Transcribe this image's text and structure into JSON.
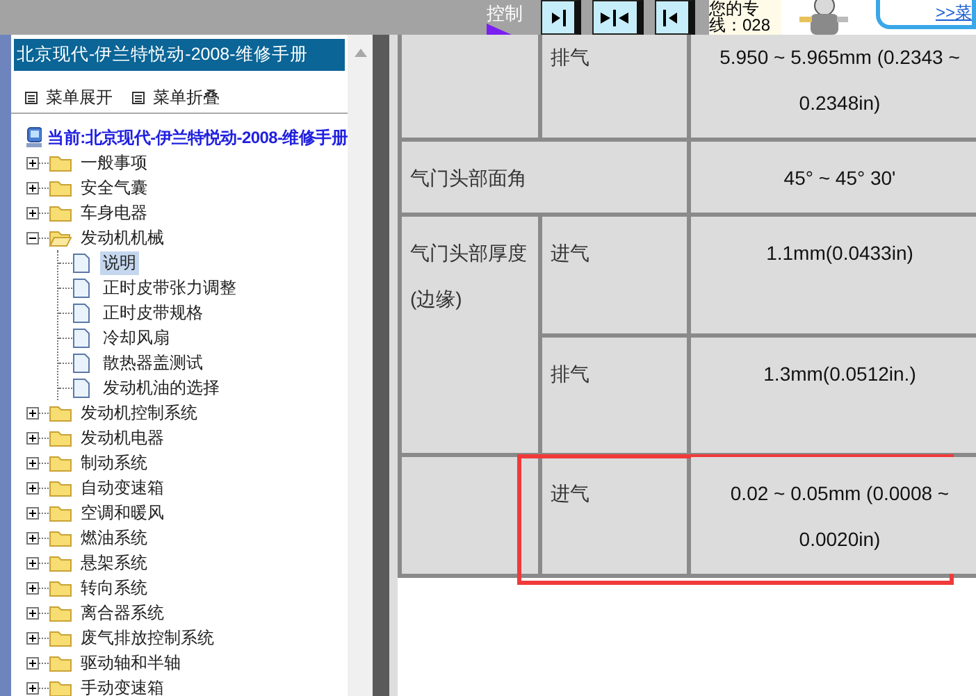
{
  "top_bar": {
    "control_label": "控制",
    "banner": {
      "lines": [
        "您的专",
        "线：028"
      ],
      "link": ">>菜"
    }
  },
  "sidebar": {
    "title": "北京现代-伊兰特悦动-2008-维修手册",
    "actions": [
      "菜单展开",
      "菜单折叠"
    ],
    "current": "当前:北京现代-伊兰特悦动-2008-维修手册",
    "tree": [
      {
        "label": "一般事项",
        "kind": "folder",
        "expanded": false,
        "selected": false
      },
      {
        "label": "安全气囊",
        "kind": "folder",
        "expanded": false,
        "selected": false
      },
      {
        "label": "车身电器",
        "kind": "folder",
        "expanded": false,
        "selected": false
      },
      {
        "label": "发动机机械",
        "kind": "folder",
        "expanded": true,
        "selected": false,
        "children": [
          {
            "label": "说明",
            "kind": "page",
            "selected": true
          },
          {
            "label": "正时皮带张力调整",
            "kind": "page",
            "selected": false
          },
          {
            "label": "正时皮带规格",
            "kind": "page",
            "selected": false
          },
          {
            "label": "冷却风扇",
            "kind": "page",
            "selected": false
          },
          {
            "label": "散热器盖测试",
            "kind": "page",
            "selected": false
          },
          {
            "label": "发动机油的选择",
            "kind": "page",
            "selected": false
          }
        ]
      },
      {
        "label": "发动机控制系统",
        "kind": "folder",
        "expanded": false,
        "selected": false
      },
      {
        "label": "发动机电器",
        "kind": "folder",
        "expanded": false,
        "selected": false
      },
      {
        "label": "制动系统",
        "kind": "folder",
        "expanded": false,
        "selected": false
      },
      {
        "label": "自动变速箱",
        "kind": "folder",
        "expanded": false,
        "selected": false
      },
      {
        "label": "空调和暖风",
        "kind": "folder",
        "expanded": false,
        "selected": false
      },
      {
        "label": "燃油系统",
        "kind": "folder",
        "expanded": false,
        "selected": false
      },
      {
        "label": "悬架系统",
        "kind": "folder",
        "expanded": false,
        "selected": false
      },
      {
        "label": "转向系统",
        "kind": "folder",
        "expanded": false,
        "selected": false
      },
      {
        "label": "离合器系统",
        "kind": "folder",
        "expanded": false,
        "selected": false
      },
      {
        "label": "废气排放控制系统",
        "kind": "folder",
        "expanded": false,
        "selected": false
      },
      {
        "label": "驱动轴和半轴",
        "kind": "folder",
        "expanded": false,
        "selected": false
      },
      {
        "label": "手动变速箱",
        "kind": "folder",
        "expanded": false,
        "selected": false
      }
    ]
  },
  "spec_table": {
    "rows": [
      {
        "kind": "group",
        "items": [
          {
            "sub": "排气",
            "value": "5.950 ~ 5.965mm (0.2343 ~ 0.2348in)",
            "highlighted": false
          }
        ]
      },
      {
        "kind": "merged",
        "label": "气门头部面角",
        "value": "45° ~ 45° 30'"
      },
      {
        "kind": "group",
        "label": "气门头部厚度(边缘)",
        "items": [
          {
            "sub": "进气",
            "value": "1.1mm(0.0433in)",
            "highlighted": false
          },
          {
            "sub": "排气",
            "value": "1.3mm(0.0512in.)",
            "highlighted": false
          }
        ]
      },
      {
        "kind": "group",
        "items": [
          {
            "sub": "进气",
            "value": "0.02 ~ 0.05mm (0.0008 ~ 0.0020in)",
            "highlighted": true
          }
        ]
      }
    ]
  }
}
